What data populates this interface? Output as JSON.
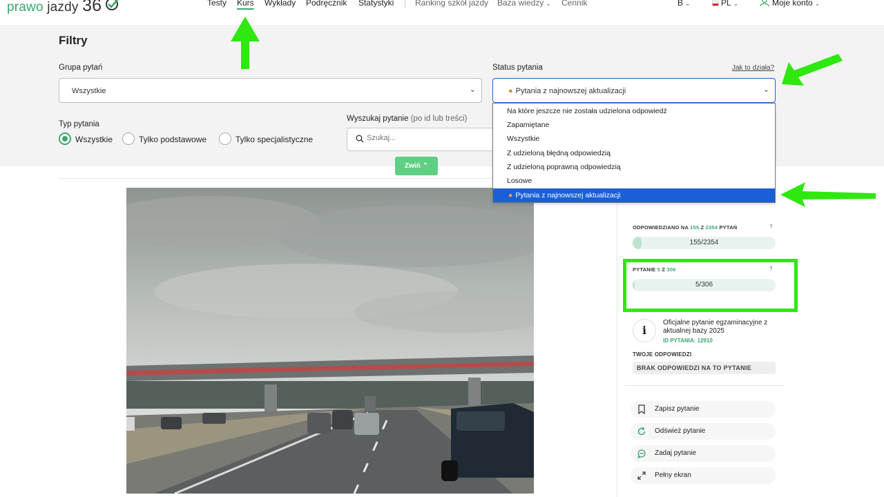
{
  "header": {
    "logo": {
      "word1": "prawo",
      "word2": "jazdy",
      "word3": "36"
    },
    "nav": [
      {
        "label": "Testy"
      },
      {
        "label": "Kurs"
      },
      {
        "label": "Wykłady"
      },
      {
        "label": "Podręcznik"
      },
      {
        "label": "Statystyki"
      },
      {
        "label": "Ranking szkół jazdy"
      },
      {
        "label": "Baza wiedzy"
      },
      {
        "label": "Cennik"
      }
    ],
    "category": "B",
    "language": "PL",
    "account": "Moje konto"
  },
  "filters": {
    "title": "Filtry",
    "group_label": "Grupa pytań",
    "group_value": "Wszystkie",
    "status_label": "Status pytania",
    "status_value": "Pytania z najnowszej aktualizacji",
    "help_link": "Jak to działa?",
    "type_label": "Typ pytania",
    "radios": [
      {
        "label": "Wszystkie",
        "checked": true
      },
      {
        "label": "Tylko podstawowe",
        "checked": false
      },
      {
        "label": "Tylko specjalistyczne",
        "checked": false
      }
    ],
    "search_label": "Wyszukaj pytanie",
    "search_hint": "(po id lub treści)",
    "search_placeholder": "Szukaj...",
    "collapse_label": "Zwiń"
  },
  "dropdown": {
    "options": [
      "Na które jeszcze nie została udzielona odpowiedź",
      "Zapamiętane",
      "Wszystkie",
      "Z udzieloną błędną odpowiedzią",
      "Z udzieloną poprawną odpowiedzią",
      "Losowe",
      "Pytania z najnowszej aktualizacji"
    ],
    "selected_index": 6
  },
  "sidebar": {
    "answered": {
      "prefix": "ODPOWIEDZIANO NA",
      "count": "155",
      "mid": "Z",
      "total": "2354",
      "suffix": "PYTAŃ",
      "bar_text": "155/2354",
      "fraction": 0.066
    },
    "question": {
      "prefix": "PYTANIE",
      "count": "5",
      "mid": "Z",
      "total": "306",
      "bar_text": "5/306",
      "fraction": 0.016
    },
    "help": "?",
    "info_icon": "i",
    "info_text": "Oficjalne pytanie egzaminacyjne z aktualnej bazy 2025",
    "question_id": "ID PYTANIA: 12910",
    "answers_label": "TWOJE ODPOWIEDZI",
    "no_answer": "BRAK ODPOWIEDZI NA TO PYTANIE",
    "actions": [
      {
        "label": "Zapisz pytanie",
        "icon": "bookmark-icon"
      },
      {
        "label": "Odśwież pytanie",
        "icon": "refresh-icon"
      },
      {
        "label": "Zadaj pytanie",
        "icon": "chat-icon"
      },
      {
        "label": "Pełny ekran",
        "icon": "fullscreen-icon"
      }
    ]
  },
  "colors": {
    "brand_green": "#3aa76d",
    "annotation_green": "#2ee80f",
    "select_blue": "#1a5fd6"
  }
}
